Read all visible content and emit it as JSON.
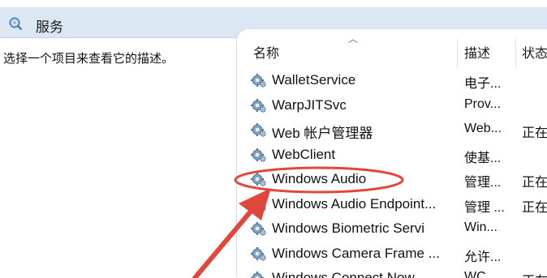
{
  "header": {
    "title": "服务"
  },
  "left_pane": {
    "description": "选择一个项目来查看它的描述。"
  },
  "columns": {
    "name": "名称",
    "description": "描述",
    "status": "状态"
  },
  "rows": [
    {
      "name": "WalletService",
      "description": "电子...",
      "status": ""
    },
    {
      "name": "WarpJITSvc",
      "description": "Prov...",
      "status": ""
    },
    {
      "name": "Web 帐户管理器",
      "description": "Web...",
      "status": "正在"
    },
    {
      "name": "WebClient",
      "description": "使基...",
      "status": ""
    },
    {
      "name": "Windows Audio",
      "description": "管理...",
      "status": "正在"
    },
    {
      "name": "Windows Audio Endpoint...",
      "description": "管理 ...",
      "status": "正在"
    },
    {
      "name": "Windows Biometric Servi",
      "description": "Win...",
      "status": ""
    },
    {
      "name": "Windows Camera Frame ...",
      "description": "允许...",
      "status": ""
    },
    {
      "name": "Windows Connect Now ...",
      "description": "WC...",
      "status": "正在"
    }
  ],
  "colors": {
    "annotation": "#e0483c",
    "header_bg": "#dbe7f3",
    "icon_blue": "#5a8fc4"
  },
  "icons": {
    "service": "gear-icon",
    "header": "gear-search-icon",
    "sort": "sort-up-icon"
  }
}
